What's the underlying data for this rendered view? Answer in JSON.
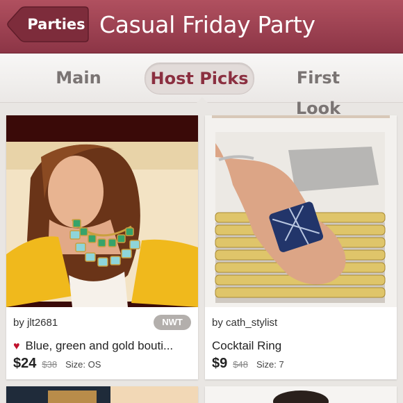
{
  "header": {
    "back_label": "Parties",
    "title": "Casual Friday Party"
  },
  "tabs": [
    {
      "label": "Main",
      "active": false
    },
    {
      "label": "Host Picks",
      "active": true
    },
    {
      "label": "First Look",
      "active": false
    }
  ],
  "listings": [
    {
      "seller": "by jlt2681",
      "badge": "NWT",
      "title": "Blue, green and gold bouti...",
      "price": "$24",
      "original_price": "$38",
      "size": "Size: OS",
      "title_icon": "lips-icon"
    },
    {
      "seller": "by cath_stylist",
      "badge": "",
      "title": "Cocktail Ring",
      "price": "$9",
      "original_price": "$48",
      "size": "Size: 7"
    }
  ],
  "colors": {
    "header": "#9a3d4f",
    "active_tab_text": "#8b2f40",
    "badge": "#b3afac"
  }
}
